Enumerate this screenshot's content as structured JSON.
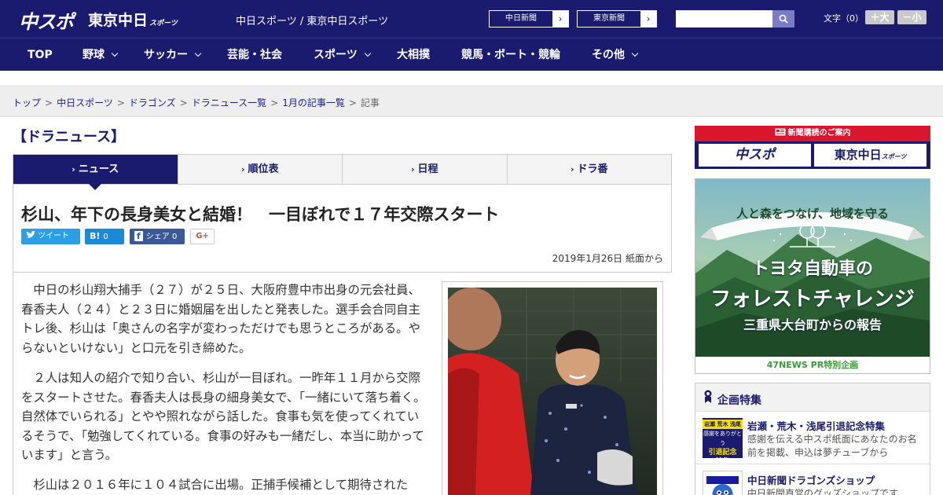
{
  "header": {
    "logo_main": "中スポ",
    "logo_tokyo": "東京中日",
    "logo_tokyo_sub": "スポーツ",
    "site_names": "中日スポーツ / 東京中日スポーツ",
    "ext_links": [
      {
        "label": "中日新聞",
        "arrow": "›"
      },
      {
        "label": "東京新聞",
        "arrow": "›"
      }
    ],
    "search_placeholder": "",
    "font_label": "文字（0）",
    "font_plus": "＋大",
    "font_minus": "－小"
  },
  "nav": {
    "items": [
      {
        "label": "TOP"
      },
      {
        "label": "野球"
      },
      {
        "label": "サッカー"
      },
      {
        "label": "芸能・社会"
      },
      {
        "label": "スポーツ"
      },
      {
        "label": "大相撲"
      },
      {
        "label": "競馬・ボート・競輪"
      },
      {
        "label": "その他"
      }
    ]
  },
  "breadcrumb": {
    "items": [
      "トップ",
      "中日スポーツ",
      "ドラゴンズ",
      "ドラニュース一覧",
      "1月の記事一覧"
    ],
    "current": "記事",
    "sep": ">"
  },
  "section_title": "【ドラニュース】",
  "tabs": [
    {
      "label": "ニュース",
      "caret": "›"
    },
    {
      "label": "順位表",
      "caret": "›"
    },
    {
      "label": "日程",
      "caret": "›"
    },
    {
      "label": "ドラ番",
      "caret": "›"
    }
  ],
  "article": {
    "headline": "杉山、年下の長身美女と結婚！　一目ぼれで１７年交際スタート",
    "share": {
      "tweet_icon": "twitter-bird-icon",
      "tweet": "ツイート",
      "hatena_icon": "B!",
      "hatena_count": "0",
      "facebook_icon": "f",
      "facebook": "シェア 0",
      "gplus": "G+"
    },
    "date": "2019年1月26日 紙面から",
    "paragraphs": [
      "中日の杉山翔大捕手（２７）が２５日、大阪府豊中市出身の元会社員、春香夫人（２４）と２３日に婚姻届を出したと発表した。選手会合同自主トレ後、杉山は「奥さんの名字が変わっただけでも思うところがある。やらないといけない」と口元を引き締めた。",
      "２人は知人の紹介で知り合い、杉山が一目ぼれ。一昨年１１月から交際をスタートさせた。春香夫人は長身の細身美女で、「一緒にいて落ち着く。自然体でいられる」とやや照れながら話した。食事も気を使ってくれているそうで、「勉強してくれている。食事の好みも一緒だし、本当に助かっています」と言う。",
      "杉山は２０１６年に１０４試合に出場。正捕手候補として期待された"
    ]
  },
  "sidebar": {
    "subscribe": {
      "head": "新聞購読のご案内",
      "logo1": "中スポ",
      "logo2": "東京中日",
      "logo2_sub": "スポーツ"
    },
    "ad": {
      "banner": "人と森をつなげ、地域を守る",
      "line1": "トヨタ自動車の",
      "line2": "フォレストチャレンジ",
      "line3": "三重県大台町からの報告",
      "footer": "47NEWS PR特別企画"
    },
    "features": {
      "title": "企画特集",
      "items": [
        {
          "title": "岩瀬・荒木・浅尾引退記念特集",
          "desc": "感謝を伝える中スポ紙面にあなたのお名前を掲載、申込は夢チューブから",
          "thumb_lines": [
            "岩瀬 荒木 浅尾",
            "感謝をありがとう",
            "引退記念",
            "特集"
          ]
        },
        {
          "title": "中日新聞ドラゴンズショップ",
          "desc": "中日新聞直営のグッズショップです",
          "thumb_lines": []
        }
      ]
    }
  },
  "colors": {
    "brand": "#1a1a6e",
    "red": "#d9162b",
    "twitter": "#2a9ee6",
    "hatena": "#1b8ad6",
    "facebook": "#3b5998"
  }
}
